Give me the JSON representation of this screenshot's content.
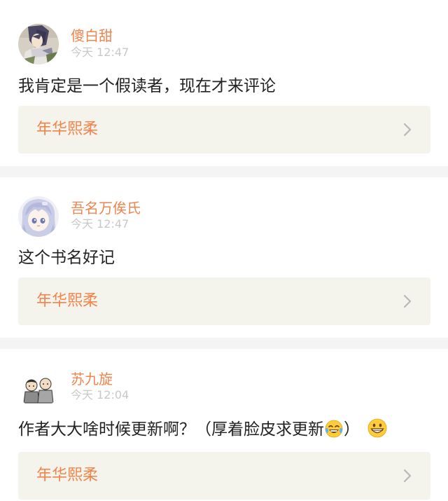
{
  "comments": [
    {
      "username": "傻白甜",
      "time": "今天 12:47",
      "text": "我肯定是一个假读者，现在才来评论",
      "book_title": "年华熙柔",
      "avatar_icon": "anime-character-avatar-icon"
    },
    {
      "username": "吾名万俟氏",
      "time": "今天 12:47",
      "text": "这个书名好记",
      "book_title": "年华熙柔",
      "avatar_icon": "anime-girl-avatar-icon"
    },
    {
      "username": "苏九旋",
      "time": "今天 12:04",
      "text_before_emoji": "作者大大啥时候更新啊？（厚着脸皮求更新",
      "text_after_emoji": "）",
      "emoji_icons": [
        "tears-of-joy-emoji-icon",
        "grinning-emoji-icon"
      ],
      "book_title": "年华熙柔",
      "avatar_icon": "cartoon-people-avatar-icon"
    }
  ],
  "colors": {
    "accent": "#f0844c",
    "timestamp": "#c8c8c8",
    "text": "#222222",
    "book_bg": "#f5f4ec",
    "separator": "#f4f4f4"
  }
}
